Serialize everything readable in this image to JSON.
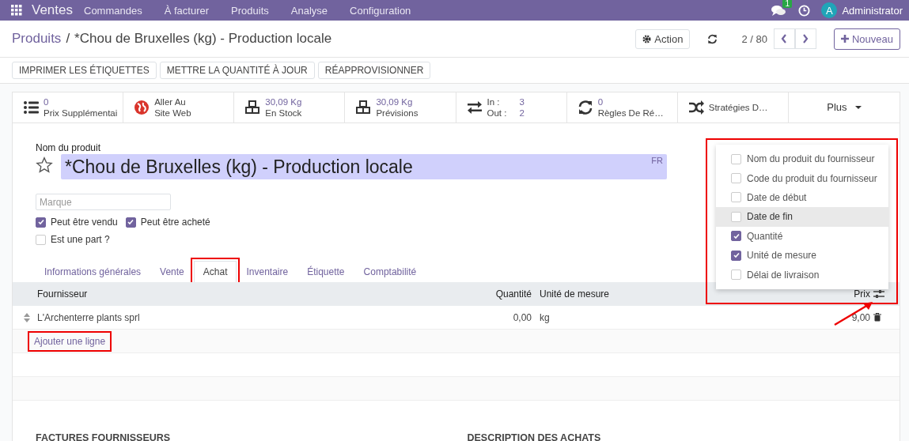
{
  "navbar": {
    "app": "Ventes",
    "menu": [
      "Commandes",
      "À facturer",
      "Produits",
      "Analyse",
      "Configuration"
    ],
    "message_count": "1",
    "user_initial": "A",
    "user": "Administrator"
  },
  "breadcrumb": {
    "parent": "Produits",
    "separator": "/",
    "current": "*Chou de Bruxelles (kg) - Production locale"
  },
  "control_panel": {
    "action": "Action",
    "pager": "2 / 80",
    "new": "Nouveau"
  },
  "action_buttons": [
    "IMPRIMER LES ÉTIQUETTES",
    "METTRE LA QUANTITÉ À JOUR",
    "RÉAPPROVISIONNER"
  ],
  "stat_buttons": [
    {
      "kind": "counter",
      "value": "0",
      "label": "Prix Supplémentai"
    },
    {
      "kind": "link",
      "value": "Aller Au",
      "label": "Site Web"
    },
    {
      "kind": "counter",
      "value": "30,09 Kg",
      "label": "En Stock"
    },
    {
      "kind": "counter",
      "value": "30,09 Kg",
      "label": "Prévisions"
    },
    {
      "kind": "inout",
      "in_label": "In :",
      "in_value": "3",
      "out_label": "Out :",
      "out_value": "2"
    },
    {
      "kind": "counter",
      "value": "0",
      "label": "Règles De Ré…"
    },
    {
      "kind": "single",
      "label": "Stratégies D…"
    },
    {
      "kind": "more",
      "label": "Plus"
    }
  ],
  "product": {
    "name_label": "Nom du produit",
    "name": "*Chou de Bruxelles (kg) - Production locale",
    "lang": "FR",
    "favorite": false,
    "brand_placeholder": "Marque",
    "flags": [
      {
        "label": "Peut être vendu",
        "checked": true
      },
      {
        "label": "Peut être acheté",
        "checked": true
      },
      {
        "label": "Est une part ?",
        "checked": false
      }
    ]
  },
  "tabs": [
    {
      "label": "Informations générales",
      "selected": false,
      "annotated": false
    },
    {
      "label": "Vente",
      "selected": false,
      "annotated": false
    },
    {
      "label": "Achat",
      "selected": true,
      "annotated": true
    },
    {
      "label": "Inventaire",
      "selected": false,
      "annotated": false
    },
    {
      "label": "Étiquette",
      "selected": false,
      "annotated": false
    },
    {
      "label": "Comptabilité",
      "selected": false,
      "annotated": false
    }
  ],
  "table": {
    "columns": [
      "Fournisseur",
      "Quantité",
      "Unité de mesure",
      "Prix"
    ],
    "rows": [
      [
        "L'Archenterre plants sprl",
        "0,00",
        "kg",
        "9,00"
      ]
    ],
    "add_line": {
      "label": "Ajouter une ligne",
      "annotated": true
    }
  },
  "column_menu": {
    "annotated": true,
    "items": [
      {
        "label": "Nom du produit du fournisseur",
        "checked": false,
        "hovered": false
      },
      {
        "label": "Code du produit du fournisseur",
        "checked": false,
        "hovered": false
      },
      {
        "label": "Date de début",
        "checked": false,
        "hovered": false
      },
      {
        "label": "Date de fin",
        "checked": false,
        "hovered": true
      },
      {
        "label": "Quantité",
        "checked": true,
        "hovered": false
      },
      {
        "label": "Unité de mesure",
        "checked": true,
        "hovered": false
      },
      {
        "label": "Délai de livraison",
        "checked": false,
        "hovered": false
      }
    ]
  },
  "sections": [
    "FACTURES FOURNISSEURS",
    "DESCRIPTION DES ACHATS"
  ]
}
